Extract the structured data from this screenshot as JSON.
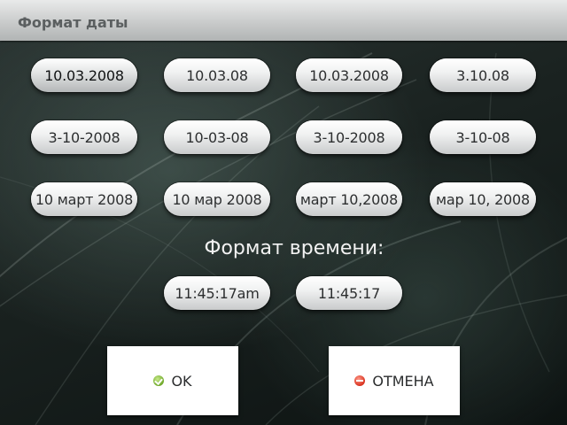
{
  "title": "Формат даты",
  "date_formats": [
    {
      "label": "10.03.2008",
      "selected": true
    },
    {
      "label": "10.03.08",
      "selected": false
    },
    {
      "label": "10.03.2008",
      "selected": false
    },
    {
      "label": "3.10.08",
      "selected": false
    },
    {
      "label": "3-10-2008",
      "selected": false
    },
    {
      "label": "10-03-08",
      "selected": false
    },
    {
      "label": "3-10-2008",
      "selected": false
    },
    {
      "label": "3-10-08",
      "selected": false
    },
    {
      "label": "10 март 2008",
      "selected": false
    },
    {
      "label": "10 мар 2008",
      "selected": false
    },
    {
      "label": "март 10,2008",
      "selected": false
    },
    {
      "label": "мар 10, 2008",
      "selected": false
    }
  ],
  "time_section_label": "Формат времени:",
  "time_formats": [
    {
      "label": "11:45:17am",
      "selected": false
    },
    {
      "label": "11:45:17",
      "selected": false
    }
  ],
  "buttons": {
    "ok": {
      "label": "OK",
      "icon": "ok-check-icon",
      "color": "#7fba33"
    },
    "cancel": {
      "label": "ОТМЕНА",
      "icon": "cancel-minus-icon",
      "color": "#e0402b"
    }
  }
}
